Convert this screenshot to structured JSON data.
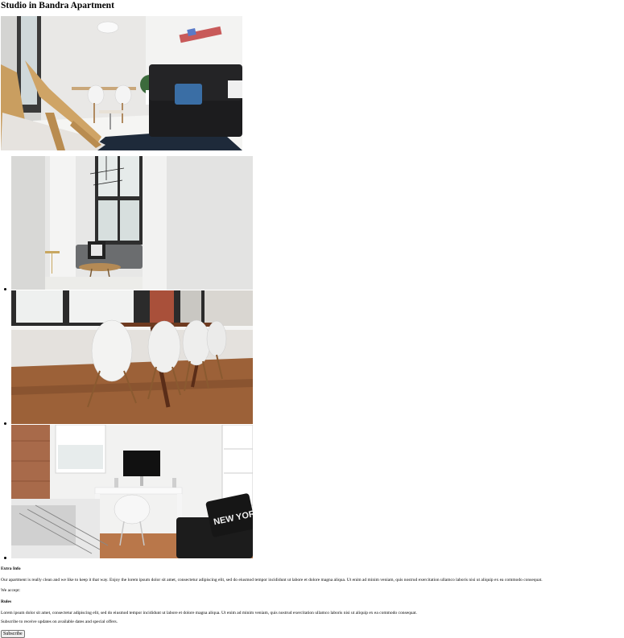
{
  "page": {
    "title": "Studio in Bandra Apartment"
  },
  "gallery": {
    "hero_alt": "Living room with wooden chair and dark sofa",
    "thumbnails": [
      {
        "alt": "Bright living room with grey sofa and round table"
      },
      {
        "alt": "Dining area with white chairs and wooden table"
      },
      {
        "alt": "Bedroom workspace with desk, monitor and New York chair"
      }
    ]
  },
  "extra_info": {
    "heading": "Extra Info",
    "text": "Our apartment is really clean and we like to keep it that way. Enjoy the lorem ipsum dolor sit amet, consectetur adipiscing elit, sed do eiusmod tempor incididunt ut labore et dolore magna aliqua. Ut enim ad minim veniam, quis nostrud exercitation ullamco laboris nisi ut aliquip ex ea commodo consequat.",
    "accept_label": "We accept:"
  },
  "rules": {
    "heading": "Rules",
    "text": "Lorem ipsum dolor sit amet, consectetur adipiscing elit, sed do eiusmod tempor incididunt ut labore et dolore magna aliqua. Ut enim ad minim veniam, quis nostrud exercitation ullamco laboris nisi ut aliquip ex ea commodo consequat."
  },
  "subscribe": {
    "text": "Subscribe to receive updates on available dates and special offers.",
    "button_label": "Subscribe"
  },
  "decor": {
    "chair_sign": "NEW YORK"
  }
}
